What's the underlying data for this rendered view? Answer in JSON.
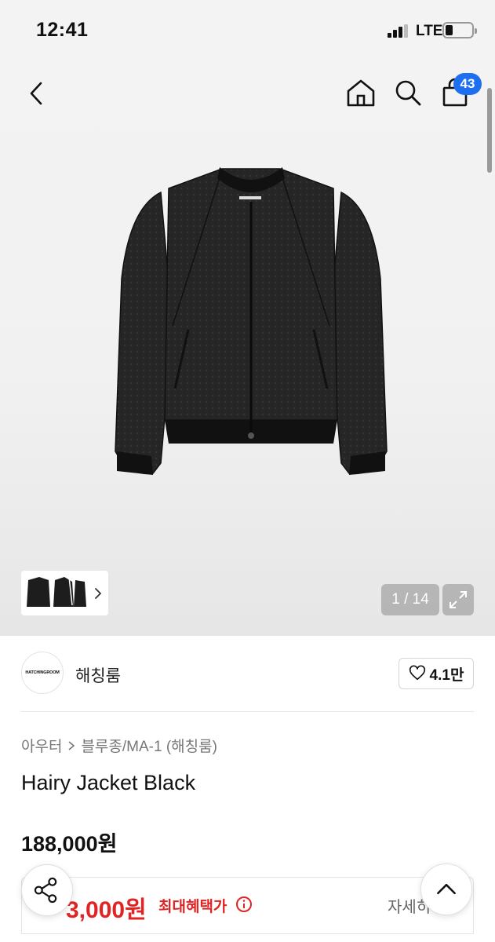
{
  "status_bar": {
    "time": "12:41",
    "network": "LTE"
  },
  "header": {
    "cart_count": "43"
  },
  "gallery": {
    "page_counter": "1 / 14"
  },
  "brand": {
    "logo_text": "HATCHINGROOM",
    "name": "해칭룸",
    "likes": "4.1만"
  },
  "breadcrumb": {
    "category": "아우터",
    "subcategory": "블루종/MA-1 (해칭룸)"
  },
  "product": {
    "title": "Hairy Jacket Black",
    "price": "188,000원"
  },
  "benefit": {
    "price": "3,000원",
    "label": "최대혜택가",
    "detail_link": "자세히"
  },
  "colors": {
    "accent_blue": "#1e6ff0",
    "benefit_red": "#e02424"
  },
  "icons": [
    "back-icon",
    "home-icon",
    "search-icon",
    "shopping-bag-icon",
    "expand-icon",
    "heart-icon",
    "info-icon",
    "share-icon",
    "chevron-up-icon",
    "chevron-right-icon"
  ]
}
